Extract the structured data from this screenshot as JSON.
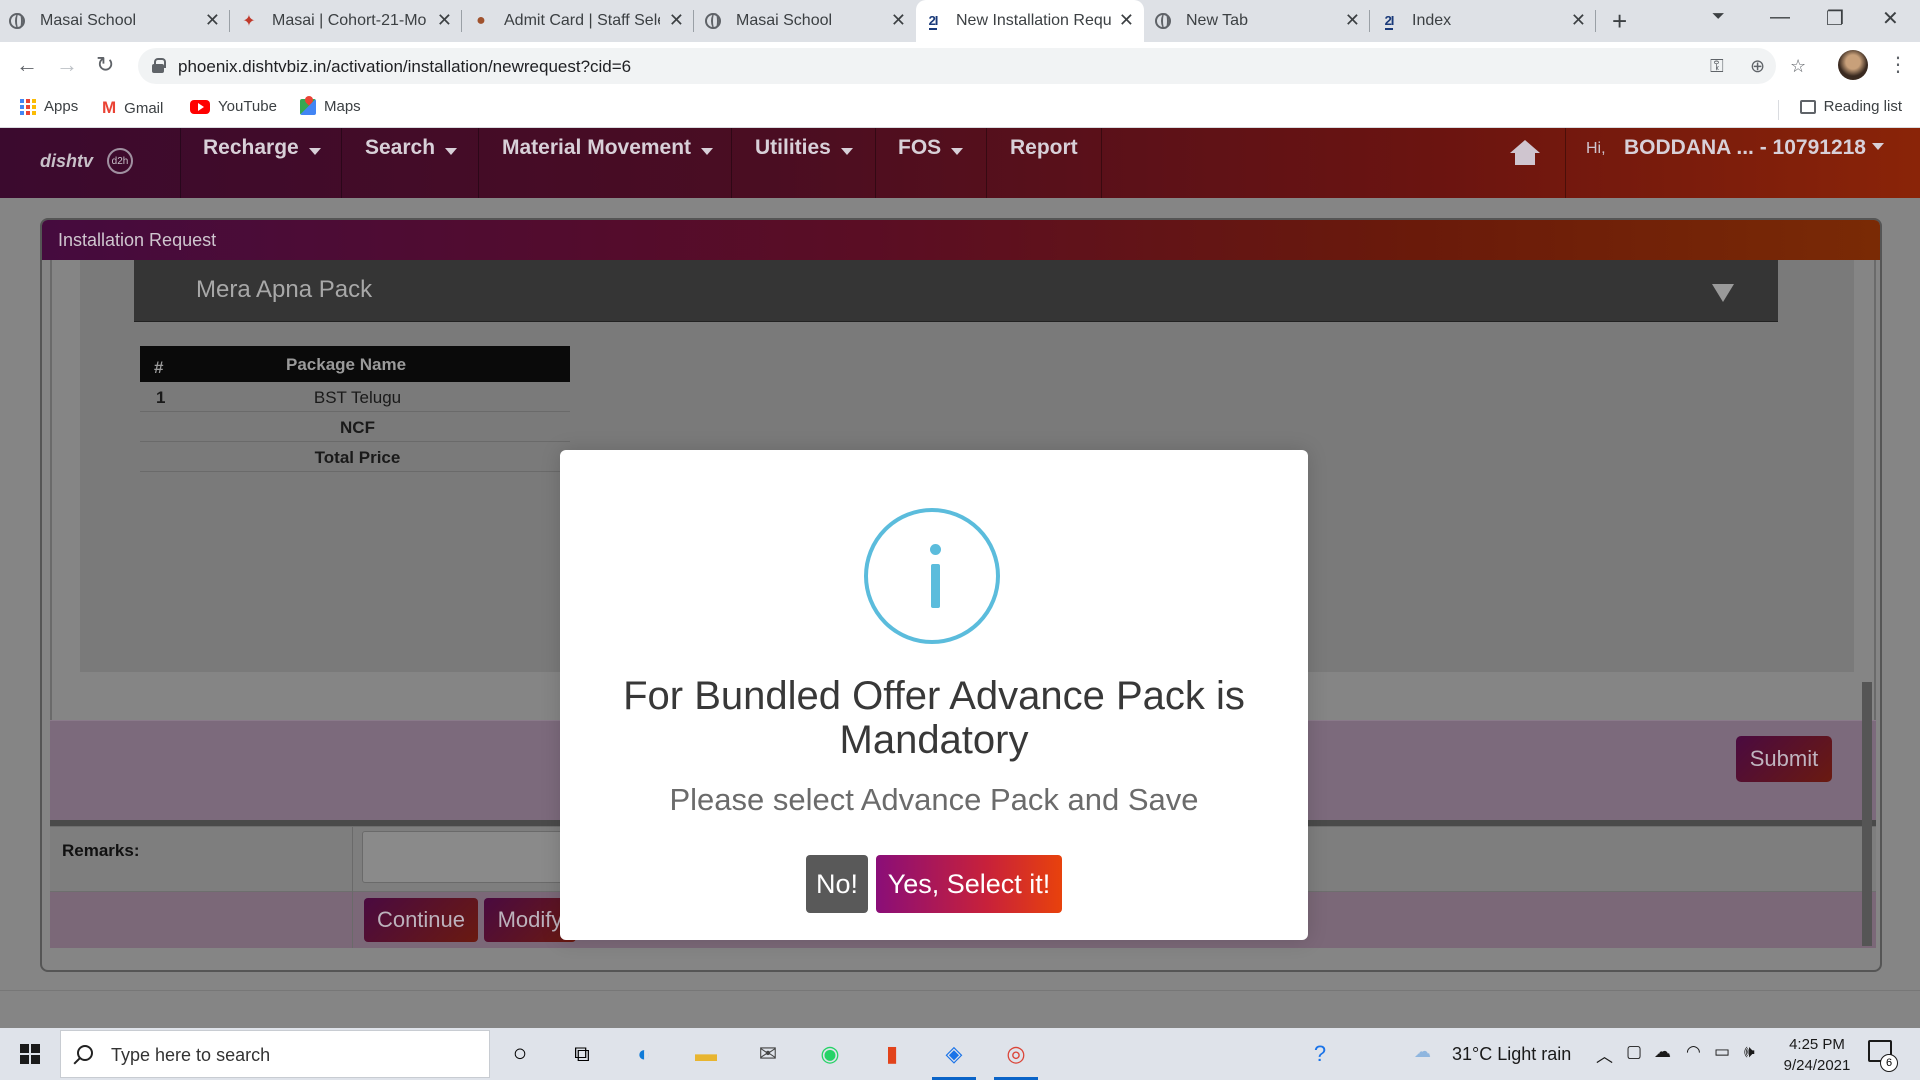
{
  "browser": {
    "tabs": [
      {
        "title": "Masai School",
        "icon": "globe-icon",
        "active": false
      },
      {
        "title": "Masai | Cohort-21-Mo",
        "icon": "masai-icon",
        "active": false
      },
      {
        "title": "Admit Card | Staff Sele",
        "icon": "emblem-icon",
        "active": false
      },
      {
        "title": "Masai School",
        "icon": "globe-icon",
        "active": false
      },
      {
        "title": "New Installation Requ",
        "icon": "d2h-icon",
        "active": true
      },
      {
        "title": "New Tab",
        "icon": "chrome-icon",
        "active": false
      },
      {
        "title": "Index",
        "icon": "d2h-icon",
        "active": false
      }
    ],
    "url": "phoenix.dishtvbiz.in/activation/installation/newrequest?cid=6",
    "bookmarks": [
      {
        "label": "Apps",
        "icon": "apps-grid-icon"
      },
      {
        "label": "Gmail",
        "icon": "gmail-icon"
      },
      {
        "label": "YouTube",
        "icon": "youtube-icon"
      },
      {
        "label": "Maps",
        "icon": "maps-icon"
      }
    ],
    "reading_list": "Reading list"
  },
  "site": {
    "brand": "dishtv",
    "brand_sub": "d2h",
    "menu": [
      {
        "label": "Recharge",
        "dropdown": true
      },
      {
        "label": "Search",
        "dropdown": true
      },
      {
        "label": "Material Movement",
        "dropdown": true
      },
      {
        "label": "Utilities",
        "dropdown": true
      },
      {
        "label": "FOS",
        "dropdown": true
      },
      {
        "label": "Report",
        "dropdown": false
      }
    ],
    "greeting": "Hi,",
    "user": "BODDANA ... - 10791218"
  },
  "panel": {
    "title": "Installation Request",
    "pack_title": "Mera Apna Pack",
    "table": {
      "headers": [
        "#",
        "Package Name"
      ],
      "rows": [
        {
          "num": "1",
          "name": "BST Telugu"
        },
        {
          "num": "",
          "name": "NCF"
        },
        {
          "num": "",
          "name": "Total Price"
        }
      ]
    },
    "submit_label": "Submit",
    "remarks_label": "Remarks:",
    "continue_label": "Continue",
    "modify_label": "Modify"
  },
  "modal": {
    "title": "For Bundled Offer Advance Pack is Mandatory",
    "text": "Please select Advance Pack and Save",
    "no_label": "No!",
    "yes_label": "Yes, Select it!",
    "icon": "info-icon",
    "icon_color": "#5bbcdc",
    "yes_gradient": [
      "#8a0e78",
      "#e8420c"
    ]
  },
  "taskbar": {
    "search_placeholder": "Type here to search",
    "weather": "31°C  Light rain",
    "time": "4:25 PM",
    "date": "9/24/2021",
    "notifications": "6"
  }
}
